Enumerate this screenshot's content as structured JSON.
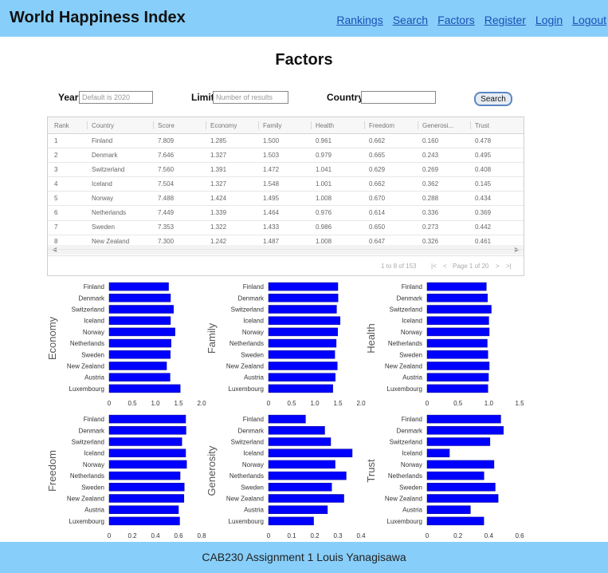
{
  "header": {
    "title": "World Happiness Index",
    "nav": [
      "Rankings",
      "Search",
      "Factors",
      "Register",
      "Login",
      "Logout"
    ]
  },
  "page_title": "Factors",
  "controls": {
    "year_label": "Year:",
    "year_placeholder": "Default is 2020",
    "limit_label": "Limit:",
    "limit_placeholder": "Number of results",
    "country_label": "Country:",
    "country_value": "",
    "search_label": "Search"
  },
  "table": {
    "columns": [
      "Rank",
      "Country",
      "Score",
      "Economy",
      "Family",
      "Health",
      "Freedom",
      "Generosi...",
      "Trust"
    ],
    "rows": [
      [
        "1",
        "Finland",
        "7.809",
        "1.285",
        "1.500",
        "0.961",
        "0.662",
        "0.160",
        "0.478"
      ],
      [
        "2",
        "Denmark",
        "7.646",
        "1.327",
        "1.503",
        "0.979",
        "0.665",
        "0.243",
        "0.495"
      ],
      [
        "3",
        "Switzerland",
        "7.560",
        "1.391",
        "1.472",
        "1.041",
        "0.629",
        "0.269",
        "0.408"
      ],
      [
        "4",
        "Iceland",
        "7.504",
        "1.327",
        "1.548",
        "1.001",
        "0.662",
        "0.362",
        "0.145"
      ],
      [
        "5",
        "Norway",
        "7.488",
        "1.424",
        "1.495",
        "1.008",
        "0.670",
        "0.288",
        "0.434"
      ],
      [
        "6",
        "Netherlands",
        "7.449",
        "1.339",
        "1.464",
        "0.976",
        "0.614",
        "0.336",
        "0.369"
      ],
      [
        "7",
        "Sweden",
        "7.353",
        "1.322",
        "1.433",
        "0.986",
        "0.650",
        "0.273",
        "0.442"
      ],
      [
        "8",
        "New Zealand",
        "7.300",
        "1.242",
        "1.487",
        "1.008",
        "0.647",
        "0.326",
        "0.461"
      ]
    ],
    "pager": {
      "summary": "1 to 8 of 153",
      "first": "|<",
      "prev": "<",
      "page_text": "Page 1 of 20",
      "next": ">",
      "last": ">|"
    },
    "scroll_left": "◀",
    "scroll_right": "▶"
  },
  "chart_data": [
    {
      "type": "bar",
      "orientation": "horizontal",
      "ylabel": "Economy",
      "categories": [
        "Finland",
        "Denmark",
        "Switzerland",
        "Iceland",
        "Norway",
        "Netherlands",
        "Sweden",
        "New Zealand",
        "Austria",
        "Luxembourg"
      ],
      "values": [
        1.285,
        1.327,
        1.391,
        1.327,
        1.424,
        1.339,
        1.322,
        1.242,
        1.317,
        1.537
      ],
      "xlim": [
        0,
        2.0
      ],
      "xticks": [
        "0",
        "0.5",
        "1.0",
        "1.5",
        "2.0"
      ],
      "color": "#0000ff"
    },
    {
      "type": "bar",
      "orientation": "horizontal",
      "ylabel": "Family",
      "categories": [
        "Finland",
        "Denmark",
        "Switzerland",
        "Iceland",
        "Norway",
        "Netherlands",
        "Sweden",
        "New Zealand",
        "Austria",
        "Luxembourg"
      ],
      "values": [
        1.5,
        1.503,
        1.472,
        1.548,
        1.495,
        1.464,
        1.433,
        1.487,
        1.443,
        1.39
      ],
      "xlim": [
        0,
        2.0
      ],
      "xticks": [
        "0",
        "0.5",
        "1.0",
        "1.5",
        "2.0"
      ],
      "color": "#0000ff"
    },
    {
      "type": "bar",
      "orientation": "horizontal",
      "ylabel": "Health",
      "categories": [
        "Finland",
        "Denmark",
        "Switzerland",
        "Iceland",
        "Norway",
        "Netherlands",
        "Sweden",
        "New Zealand",
        "Austria",
        "Luxembourg"
      ],
      "values": [
        0.961,
        0.979,
        1.041,
        1.001,
        1.008,
        0.976,
        0.986,
        1.008,
        0.996,
        0.986
      ],
      "xlim": [
        0,
        1.5
      ],
      "xticks": [
        "0",
        "0.5",
        "1.0",
        "1.5"
      ],
      "color": "#0000ff"
    },
    {
      "type": "bar",
      "orientation": "horizontal",
      "ylabel": "Freedom",
      "categories": [
        "Finland",
        "Denmark",
        "Switzerland",
        "Iceland",
        "Norway",
        "Netherlands",
        "Sweden",
        "New Zealand",
        "Austria",
        "Luxembourg"
      ],
      "values": [
        0.662,
        0.665,
        0.629,
        0.662,
        0.67,
        0.614,
        0.65,
        0.647,
        0.6,
        0.61
      ],
      "xlim": [
        0,
        0.8
      ],
      "xticks": [
        "0",
        "0.2",
        "0.4",
        "0.6",
        "0.8"
      ],
      "color": "#0000ff"
    },
    {
      "type": "bar",
      "orientation": "horizontal",
      "ylabel": "Generosity",
      "categories": [
        "Finland",
        "Denmark",
        "Switzerland",
        "Iceland",
        "Norway",
        "Netherlands",
        "Sweden",
        "New Zealand",
        "Austria",
        "Luxembourg"
      ],
      "values": [
        0.16,
        0.243,
        0.269,
        0.362,
        0.288,
        0.336,
        0.273,
        0.326,
        0.255,
        0.195
      ],
      "xlim": [
        0,
        0.4
      ],
      "xticks": [
        "0",
        "0.1",
        "0.2",
        "0.3",
        "0.4"
      ],
      "color": "#0000ff"
    },
    {
      "type": "bar",
      "orientation": "horizontal",
      "ylabel": "Trust",
      "categories": [
        "Finland",
        "Denmark",
        "Switzerland",
        "Iceland",
        "Norway",
        "Netherlands",
        "Sweden",
        "New Zealand",
        "Austria",
        "Luxembourg"
      ],
      "values": [
        0.478,
        0.495,
        0.408,
        0.145,
        0.434,
        0.369,
        0.442,
        0.461,
        0.281,
        0.368
      ],
      "xlim": [
        0,
        0.6
      ],
      "xticks": [
        "0",
        "0.2",
        "0.4",
        "0.6"
      ],
      "color": "#0000ff"
    }
  ],
  "footer": {
    "text": "CAB230 Assignment 1 Louis Yanagisawa"
  }
}
